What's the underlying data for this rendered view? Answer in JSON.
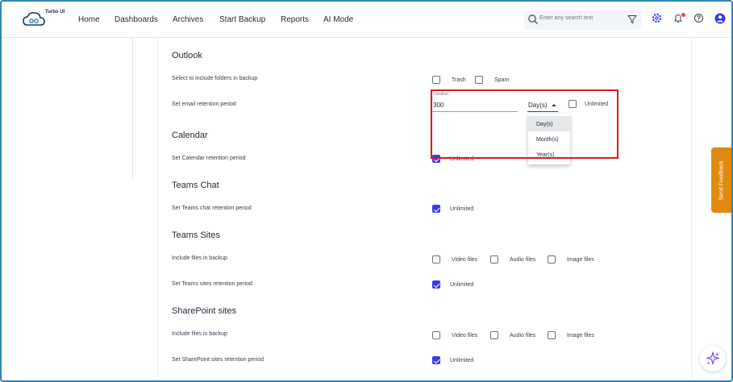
{
  "app": {
    "logo_text": "Turbo UI"
  },
  "nav": {
    "items": [
      "Home",
      "Dashboards",
      "Archives",
      "Start Backup",
      "Reports",
      "AI Mode"
    ]
  },
  "search": {
    "placeholder": "Enter any search text"
  },
  "sections": {
    "outlook": {
      "title": "Outlook",
      "folders_label": "Select to include folders in backup",
      "folders": [
        {
          "label": "Trash",
          "checked": false
        },
        {
          "label": "Spam",
          "checked": false
        }
      ],
      "retention_label": "Set email retention period",
      "duration_label": "Duration",
      "duration_value": "300",
      "unit_value": "Day(s)",
      "unlimited_label": "Unlimited",
      "unlimited_checked": false,
      "unit_options": [
        "Day(s)",
        "Month(s)",
        "Year(s)"
      ]
    },
    "calendar": {
      "title": "Calendar",
      "retention_label": "Set Calendar retention period",
      "unlimited_label": "Unlimited",
      "unlimited_checked": true
    },
    "teams_chat": {
      "title": "Teams Chat",
      "retention_label": "Set Teams chat retention period",
      "unlimited_label": "Unlimited",
      "unlimited_checked": true
    },
    "teams_sites": {
      "title": "Teams Sites",
      "files_label": "Include files in backup",
      "files": [
        "Video files",
        "Audio files",
        "Image files"
      ],
      "retention_label": "Set Teams sites retention period",
      "unlimited_label": "Unlimited",
      "unlimited_checked": true
    },
    "sharepoint": {
      "title": "SharePoint sites",
      "files_label": "Include files in backup",
      "files": [
        "Video files",
        "Audio files",
        "Image files"
      ],
      "retention_label": "Set SharePoint sites retention period",
      "unlimited_label": "Unlimited",
      "unlimited_checked": true
    }
  },
  "feedback": {
    "label": "Send Feedback"
  },
  "colors": {
    "accent": "#3b3be8",
    "highlight": "#e0171f",
    "feedback": "#e08a11",
    "frame": "#2e86b5"
  },
  "icons": [
    "logo-cloud-icon",
    "search-icon",
    "filter-icon",
    "settings-gear-icon",
    "bell-icon",
    "help-icon",
    "user-avatar-icon",
    "ai-sparkle-icon"
  ]
}
